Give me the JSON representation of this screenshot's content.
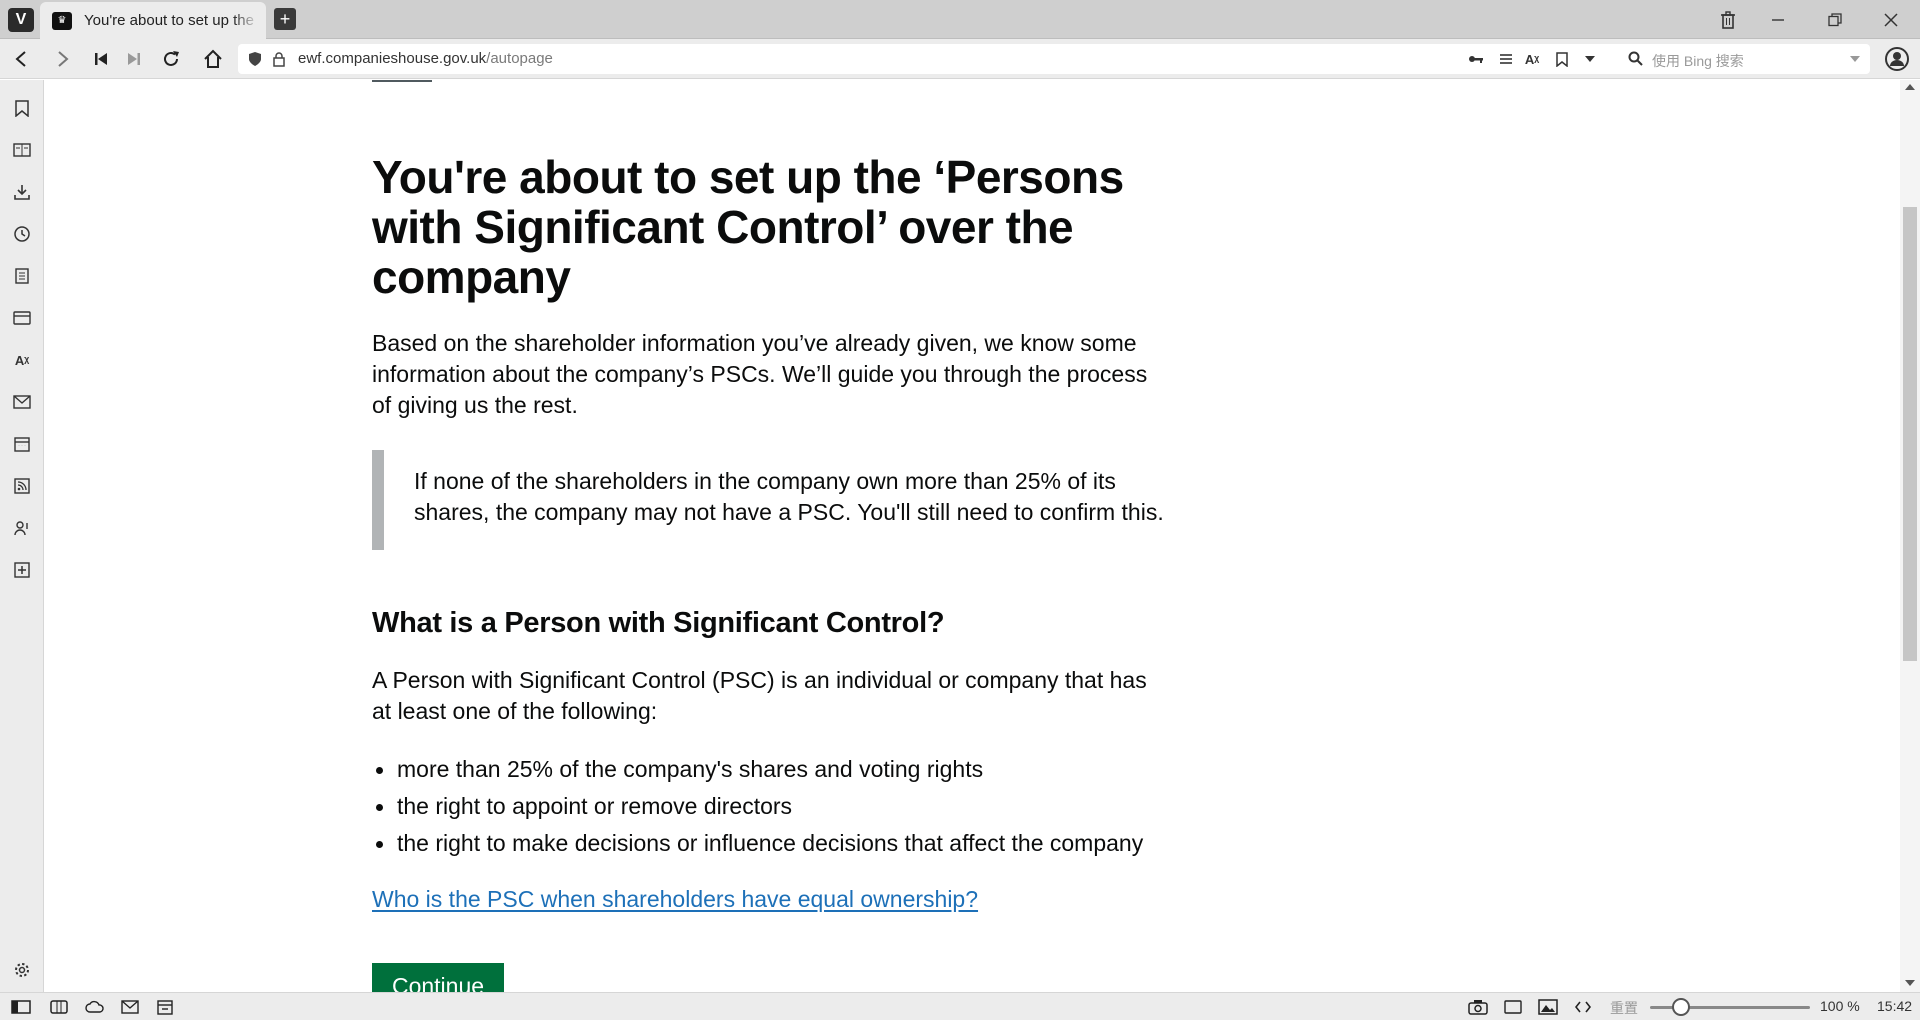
{
  "browser": {
    "tab_title": "You're about to set up the",
    "new_tab_symbol": "+",
    "url_domain": "ewf.companieshouse.gov.uk",
    "url_path": "/autopage",
    "search_placeholder": "使用 Bing 搜索"
  },
  "page": {
    "title": "You're about to set up the ‘Persons with Significant Control’ over the company",
    "intro": "Based on the shareholder information you’ve already given, we know some information about the company’s PSCs. We’ll guide you through the process of giving us the rest.",
    "inset_text": "If none of the shareholders in the company own more than 25% of its shares, the company may not have a PSC. You'll still need to confirm this.",
    "psc_heading": "What is a Person with Significant Control?",
    "psc_definition": "A Person with Significant Control (PSC) is an individual or company that has at least one of the following:",
    "psc_list": [
      "more than 25% of the company's shares and voting rights",
      "the right to appoint or remove directors",
      "the right to make decisions or influence decisions that affect the company"
    ],
    "equal_ownership_link": "Who is the PSC when shareholders have equal ownership?",
    "continue_label": "Continue"
  },
  "statusbar": {
    "zoom_label": "重置",
    "zoom_percent": "100 %",
    "zoom_level": 1.0,
    "clock": "15:42"
  },
  "colors": {
    "link": "#1d70b8",
    "button": "#00703c",
    "inset_border": "#b1b4b6",
    "text": "#0b0c0c"
  }
}
